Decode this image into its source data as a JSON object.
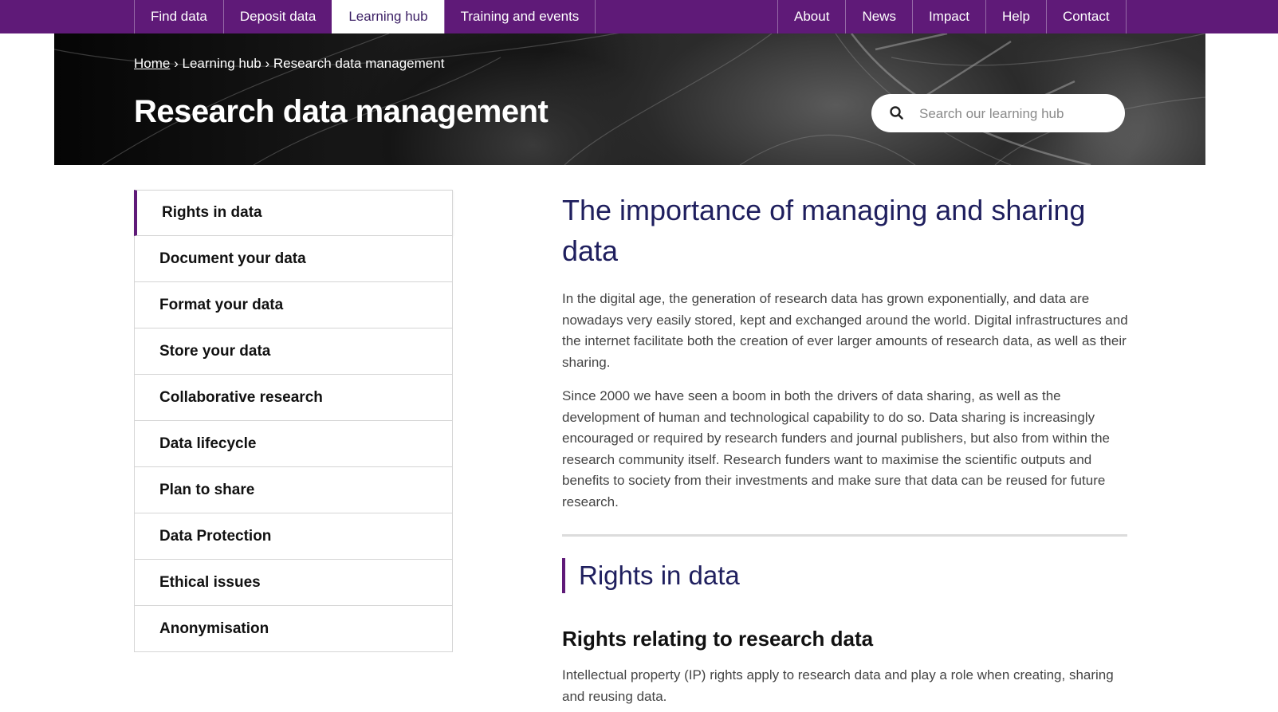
{
  "nav": {
    "left": [
      "Find data",
      "Deposit data",
      "Learning hub",
      "Training and events"
    ],
    "right": [
      "About",
      "News",
      "Impact",
      "Help",
      "Contact"
    ],
    "active": "Learning hub"
  },
  "breadcrumb": {
    "home": "Home",
    "separator": "›",
    "level2": "Learning hub",
    "current": "Research data management"
  },
  "hero": {
    "title": "Research data management"
  },
  "search": {
    "placeholder": "Search our learning hub",
    "icon": "search-icon"
  },
  "sidebar": {
    "items": [
      "Rights in data",
      "Document your data",
      "Format your data",
      "Store your data",
      "Collaborative research",
      "Data lifecycle",
      "Plan to share",
      "Data Protection",
      "Ethical issues",
      "Anonymisation"
    ]
  },
  "main": {
    "heading": "The importance of managing and sharing data",
    "paragraph1": "In the digital age, the generation of research data has grown exponentially, and data are nowadays very easily stored, kept and exchanged around the world. Digital infrastructures and the internet facilitate both the creation of ever larger amounts of research data, as well as their sharing.",
    "paragraph2": "Since 2000 we have seen a boom in both the drivers of data sharing, as well as the development of human and technological capability to do so. Data sharing is increasingly encouraged or required by research funders and journal publishers, but also from within the research community itself. Research funders want to maximise the scientific outputs and benefits to society from their investments and make sure that data can be reused for future research.",
    "section_heading": "Rights in data",
    "subheading": "Rights relating to research data",
    "paragraph3": "Intellectual property (IP) rights apply to research data and play a role when creating, sharing and reusing data."
  },
  "colors": {
    "brand_purple": "#5f1a78",
    "heading_navy": "#1f1f5e"
  }
}
